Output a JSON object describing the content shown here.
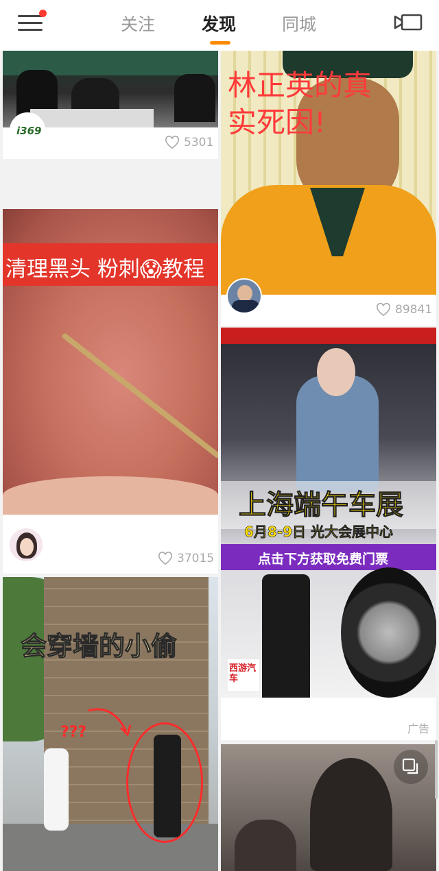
{
  "nav": {
    "tabs": [
      {
        "label": "关注"
      },
      {
        "label": "发现"
      },
      {
        "label": "同城"
      }
    ],
    "active_tab": "发现",
    "accent": "#ff8a00"
  },
  "feed": {
    "cards": [
      {
        "id": "c1",
        "likes": "5301",
        "avatar_text": "i369"
      },
      {
        "id": "c2",
        "likes": "89841",
        "overlay": "林正英的真实死因!",
        "overlay_lines": [
          "林正英的真",
          "实死因!"
        ]
      },
      {
        "id": "c3",
        "likes": "37015",
        "overlay": "清理黑头 粉刺😱教程"
      },
      {
        "id": "c4",
        "ad_label": "广告",
        "headline": "上海端午车展",
        "subline": "6月8-9日 光大会展中心",
        "cta": "点击下方获取免费门票",
        "brand_logo": "西游汽车"
      },
      {
        "id": "c5",
        "overlay": "会穿墙的小偷",
        "marks": "???"
      },
      {
        "id": "c6"
      }
    ]
  }
}
